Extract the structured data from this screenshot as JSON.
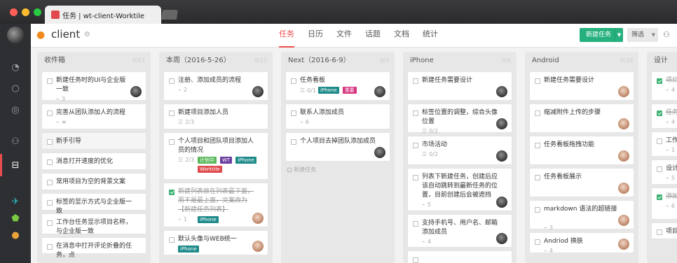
{
  "window": {
    "tab_title": "任务 | wt-client-Worktile",
    "lights": [
      "#ff5f57",
      "#febc2e",
      "#28c840"
    ]
  },
  "header": {
    "project_name": "client",
    "nav": [
      "任务",
      "日历",
      "文件",
      "话题",
      "文档",
      "统计"
    ],
    "active_nav": 0,
    "new_task_label": "新建任务",
    "filter_label": "筛选"
  },
  "colors": {
    "accent": "#e94e4e",
    "green": "#26b07d",
    "tag_teal": "#1e8a8a",
    "tag_green": "#5cb85c",
    "tag_purple": "#6b3fa0",
    "tag_red": "#e0494d",
    "tag_magenta": "#d6337f"
  },
  "columns": [
    {
      "name": "收件箱",
      "count": "0/17",
      "cards": [
        {
          "title": "新建任务时的UI与企业版一致",
          "meta": [
            "3"
          ],
          "avatar": "dark",
          "h": 42
        },
        {
          "title": "完善从团队添加人的流程",
          "meta": [
            "≡"
          ],
          "h": 37
        },
        {
          "title": "新手引导",
          "faded": true,
          "h": 25
        },
        {
          "title": "消息打开速度的优化",
          "h": 25
        },
        {
          "title": "常用项目为空的背景文案",
          "h": 25
        },
        {
          "title": "标签的显示方式与企业版一致",
          "h": 25
        },
        {
          "title": "工作台任务显示项目名称，与企业版一致",
          "h": 30
        },
        {
          "title": "在消息中打开评论折叠的任务，点",
          "h": 24
        }
      ]
    },
    {
      "name": "本周（2016-5-26）",
      "count": "0/12",
      "cards": [
        {
          "title": "注册、添加成员的流程",
          "meta": [
            "2"
          ],
          "avatar": "dark",
          "h": 42
        },
        {
          "title": "新建项目添加人员",
          "meta": [
            "2/3"
          ],
          "h": 37
        },
        {
          "title": "个人项目和团队项目添加人员的情况",
          "meta": [
            "2/3"
          ],
          "tags": [
            [
              "计划中",
              "tag_green"
            ],
            [
              "WT",
              "tag_purple"
            ],
            [
              "iPhone",
              "tag_teal"
            ],
            [
              "Worktile",
              "tag_red"
            ]
          ],
          "h": 68
        },
        {
          "title": "新建列表放在列表最下面，而不是最上面，文案改为【新建任务列表】",
          "done": true,
          "meta": [
            "1"
          ],
          "tags": [
            [
              "iPhone",
              "tag_teal"
            ]
          ],
          "avatar": "warm",
          "h": 64
        },
        {
          "title": "默认头像与WEB统一",
          "tags": [
            [
              "iPhone",
              "tag_teal"
            ]
          ],
          "avatar": "warm",
          "h": 36
        }
      ]
    },
    {
      "name": "Next（2016-6-9）",
      "count": "0/3",
      "cards": [
        {
          "title": "任务看板",
          "meta": [
            "0/1"
          ],
          "tags": [
            [
              "iPhone",
              "tag_teal"
            ],
            [
              "重要",
              "tag_magenta"
            ]
          ],
          "avatar": "dark",
          "h": 42
        },
        {
          "title": "联系人添加成员",
          "meta": [
            "6"
          ],
          "h": 37
        },
        {
          "title": "个人项目去掉团队添加成员",
          "avatar": "dark",
          "h": 42
        }
      ],
      "add_label": "新建任务"
    },
    {
      "name": "iPhone",
      "count": "0/8",
      "cards": [
        {
          "title": "新建任务需要设计",
          "avatar": "dark",
          "h": 42
        },
        {
          "title": "标签位置的调整，综合头像位置",
          "meta": [
            "0/2"
          ],
          "avatar": "dark",
          "h": 42
        },
        {
          "title": "市场活动",
          "meta": [
            "0/2"
          ],
          "avatar": "dark",
          "h": 42
        },
        {
          "title": "列表下新建任务，创建后应该自动跳转到最新任务的位置，目前创建后会被遮挡",
          "meta": [
            "5"
          ],
          "avatar": "dark",
          "h": 62
        },
        {
          "title": "支持手机号、用户名、邮箱添加成员",
          "meta": [
            "4"
          ],
          "avatar": "dark",
          "h": 48
        },
        {
          "title": "",
          "h": 30
        }
      ]
    },
    {
      "name": "Android",
      "count": "0/10",
      "cards": [
        {
          "title": "新建任务需要设计",
          "avatar": "warm",
          "h": 42
        },
        {
          "title": "缩减附件上传的步骤",
          "avatar": "warm",
          "h": 42
        },
        {
          "title": "任务看板拖拽功能",
          "avatar": "warm",
          "h": 42
        },
        {
          "title": "任务看板展示",
          "avatar": "warm",
          "h": 42
        },
        {
          "title": "markdown 语法的超链接",
          "meta": [
            "3"
          ],
          "avatar": "warm",
          "h": 42
        },
        {
          "title": "Andriod 换肤",
          "meta": [
            "4"
          ],
          "avatar": "warm",
          "h": 30
        }
      ]
    },
    {
      "name": "设计",
      "count": "",
      "cards": [
        {
          "title": "项目概",
          "done": true,
          "meta": [
            "4"
          ],
          "avatar": "dark",
          "h": 42
        },
        {
          "title": "任务模",
          "done": true,
          "meta": [
            "4"
          ],
          "h": 36
        },
        {
          "title": "工作台",
          "meta": [
            "1"
          ],
          "h": 36
        },
        {
          "title": "设计二",
          "meta": [
            "5"
          ],
          "h": 36
        },
        {
          "title": "添加的 em",
          "done": true,
          "meta": [
            "6"
          ],
          "h": 46
        },
        {
          "title": "项目中",
          "h": 24
        }
      ]
    }
  ]
}
